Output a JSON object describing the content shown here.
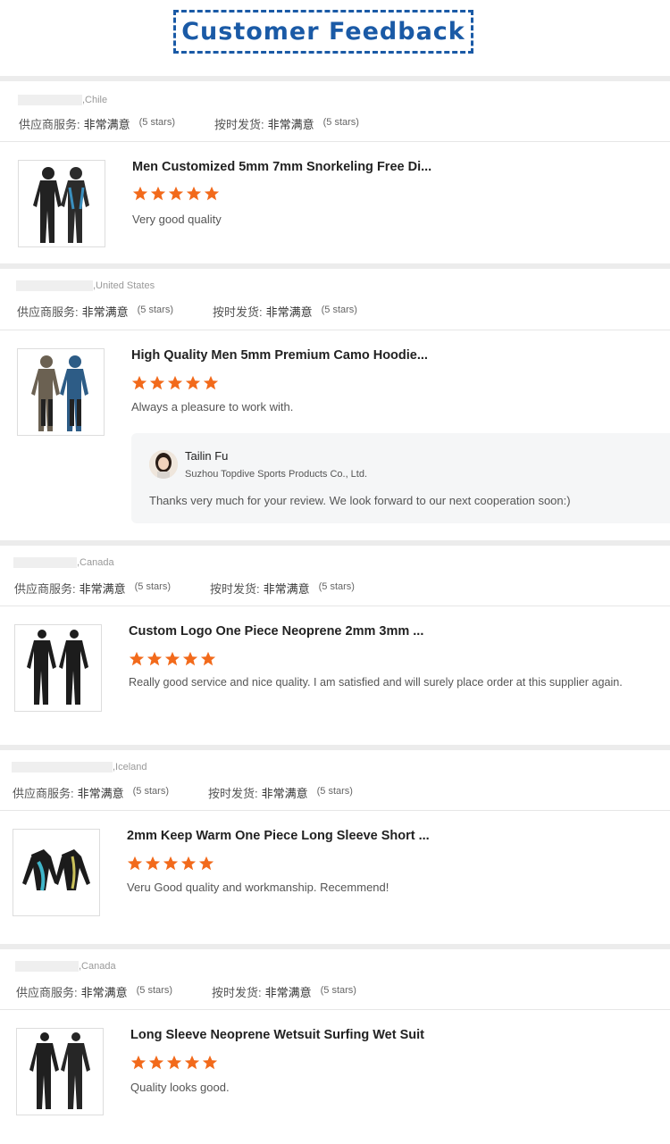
{
  "header": {
    "title": "Customer Feedback"
  },
  "labels": {
    "supplier_service": "供应商服务:",
    "on_time": "按时发货:",
    "very_satisfied": "非常满意",
    "stars": "(5 stars)"
  },
  "colors": {
    "accent": "#1a5aa6",
    "star": "#f26a1b"
  },
  "reviews": [
    {
      "country": ",Chile",
      "product_title": "Men Customized 5mm 7mm Snorkeling Free Di...",
      "rating": 5,
      "text": "Very good quality"
    },
    {
      "country": ",United States",
      "product_title": "High Quality Men 5mm Premium Camo Hoodie...",
      "rating": 5,
      "text": "Always a pleasure to work with.",
      "reply": {
        "name": "Tailin Fu",
        "company": "Suzhou Topdive Sports Products Co., Ltd.",
        "text": "Thanks very much for your review. We look forward to our next cooperation soon:)"
      }
    },
    {
      "country": ",Canada",
      "product_title": "Custom Logo One Piece Neoprene 2mm 3mm ...",
      "rating": 5,
      "text": "Really good service and nice quality. I am satisfied and will surely place order at this supplier again."
    },
    {
      "country": ",Iceland",
      "product_title": "2mm Keep Warm One Piece Long Sleeve Short ...",
      "rating": 5,
      "text": "Veru Good quality and workmanship. Recemmend!"
    },
    {
      "country": ",Canada",
      "product_title": "Long Sleeve Neoprene Wetsuit Surfing Wet Suit",
      "rating": 5,
      "text": "Quality looks good."
    }
  ]
}
